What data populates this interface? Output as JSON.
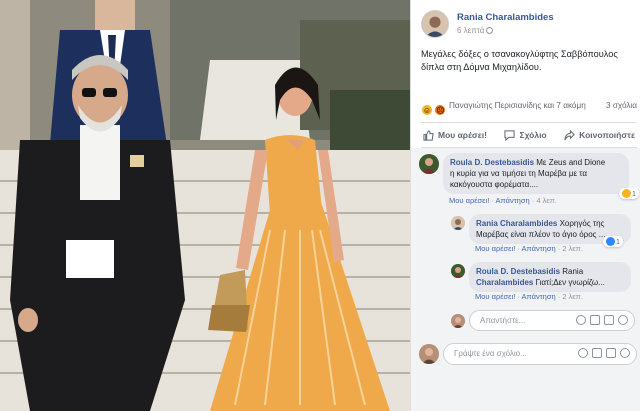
{
  "post": {
    "author": "Rania Charalambides",
    "time": "6 λεπτά",
    "text": "Μεγάλες δόξες ο τσανακογλύφτης Σαββόπουλος δίπλα στη Δόμνα Μιχαηλίδου."
  },
  "reactions": {
    "names": "Παναγιώτης Περισιανίδης και 7 ακόμη",
    "comments_count": "3 σχόλια",
    "icons": [
      "haha-reaction-icon",
      "angry-reaction-icon"
    ],
    "colors": {
      "haha": "#f7b125",
      "angry": "#e9710f"
    }
  },
  "actions": {
    "like": "Μου αρέσει!",
    "comment": "Σχόλιο",
    "share": "Κοινοποιήστε"
  },
  "comments": [
    {
      "author": "Roula D. Destebasidis",
      "text_line1": " Με Zeus and Dione",
      "text_line2": "η κυρία για να τιμήσει τη Μαρέβα με τα",
      "text_line3": "κακόγουστα φορέματα....",
      "like": "Μου αρέσει!",
      "reply": "Απάντηση",
      "time": "4 λεπ.",
      "badge": "1"
    },
    {
      "author": "Rania Charalambides",
      "text_line1": " Χορηγός της",
      "text_line2": "Μαρέβας είναι πλέον το άγιο όρος ...",
      "like": "Μου αρέσει!",
      "reply": "Απάντηση",
      "time": "2 λεπ.",
      "badge": "1"
    },
    {
      "author": "Roula D. Destebasidis",
      "text_line1": " Rania",
      "text_line2": "Charalambides",
      "text_line2b": " Γιατί;Δεν γνωρίζω...",
      "like": "Μου αρέσει!",
      "reply": "Απάντηση",
      "time": "2 λεπ."
    }
  ],
  "reply_box": {
    "placeholder": "Απαντήστε..."
  },
  "comment_box": {
    "placeholder": "Γράψτε ένα σχόλιο..."
  },
  "colors": {
    "link": "#385898",
    "accent": "#4267b2",
    "dress": "#f0a94a",
    "suit": "#1c1c1e"
  }
}
